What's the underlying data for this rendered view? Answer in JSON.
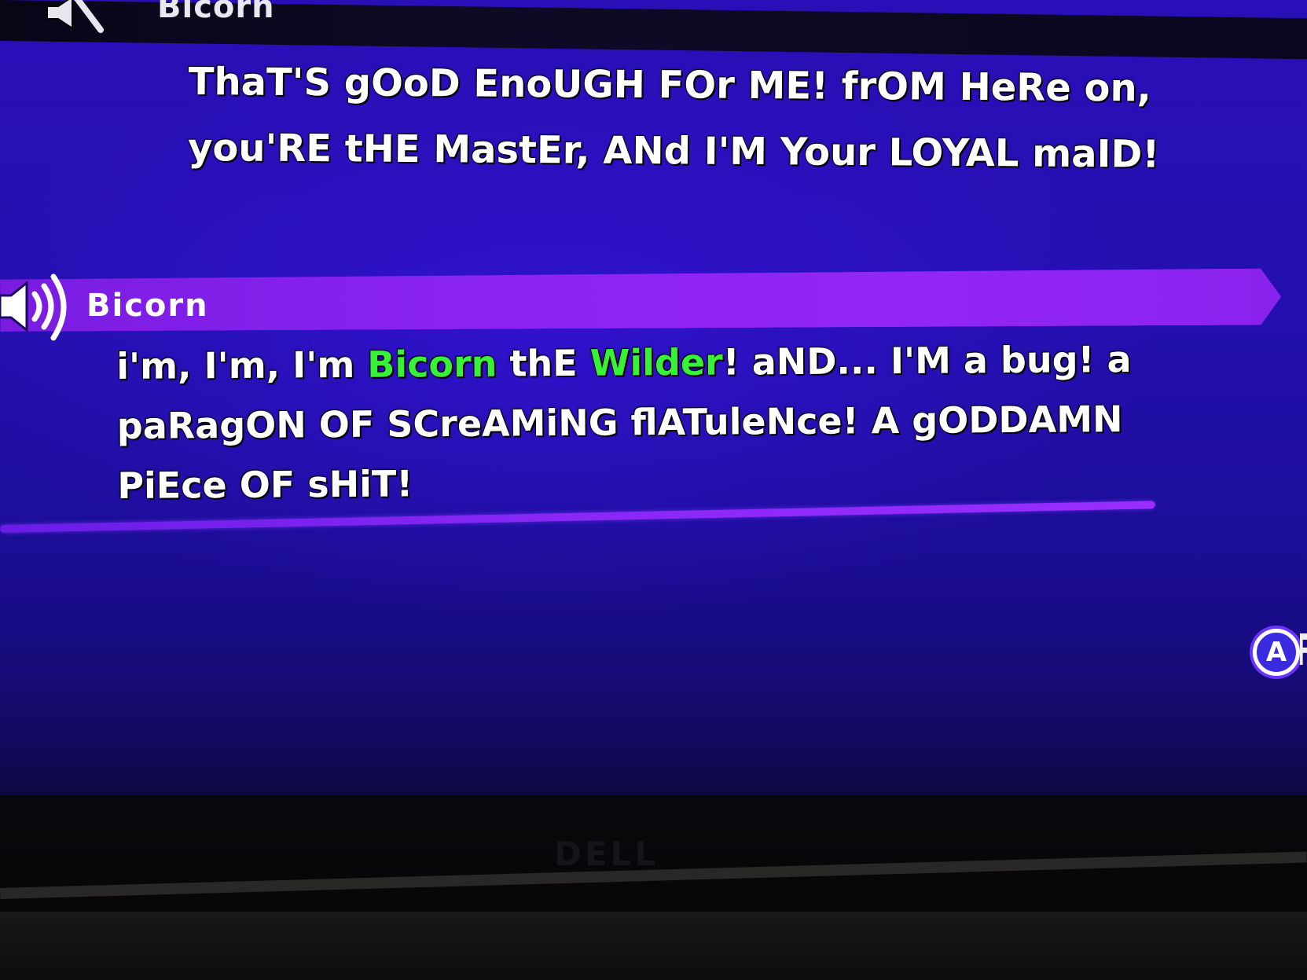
{
  "previous_entry": {
    "speaker_name": "Bicorn",
    "speaker_icon": "speaker-muted-icon",
    "dialogue": "ThaT'S gOoD EnoUGH FOr ME! frOM HeRe on, you'RE tHE MastEr, ANd I'M Your LOYAL maID!"
  },
  "current_entry": {
    "speaker_name": "Bicorn",
    "speaker_icon": "speaker-playing-icon",
    "dialogue_parts": {
      "p1": "i'm, I'm, I'm ",
      "p2": "Bicorn",
      "p3": " thE ",
      "p4": "Wilder",
      "p5": "! aND... I'M a bug! a paRagON OF SCreAMiNG flATuleNce! A gODDAMN PiEce OF sHiT!"
    },
    "highlight_color": "#38f238"
  },
  "controls": {
    "a_button_glyph": "A"
  },
  "monitor": {
    "brand": "DELL"
  },
  "colors": {
    "name_bar": "#8a22f2",
    "background": "#2410b0"
  }
}
